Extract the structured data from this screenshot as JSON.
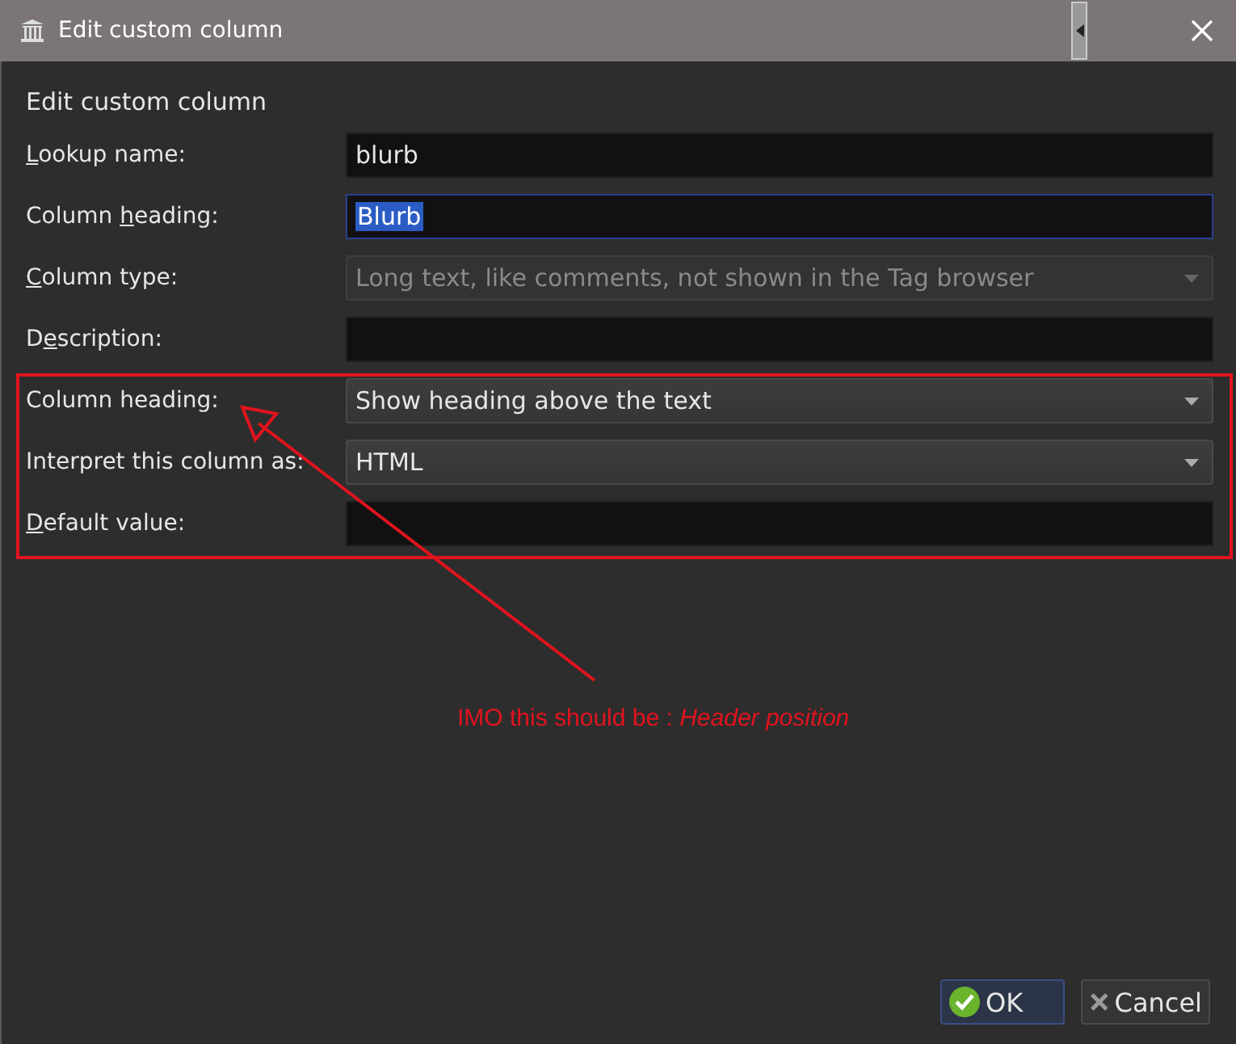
{
  "window": {
    "title": "Edit custom column"
  },
  "heading": "Edit custom column",
  "rows": [
    {
      "label_start": "",
      "access_key": "L",
      "label_end": "ookup name:",
      "kind": "text",
      "value": "blurb",
      "focused": false,
      "highlighted": false
    },
    {
      "label_start": "Column ",
      "access_key": "h",
      "label_end": "eading:",
      "kind": "text",
      "value": "Blurb",
      "focused": true,
      "highlighted": true
    },
    {
      "label_start": "",
      "access_key": "C",
      "label_end": "olumn type:",
      "kind": "combo",
      "value": "Long text, like comments, not shown in the Tag browser",
      "disabled": true
    },
    {
      "label_start": "D",
      "access_key": "e",
      "label_end": "scription:",
      "kind": "text"
    },
    {
      "label_start": "Column heading:",
      "kind": "combo",
      "value": "Show heading above the text",
      "disabled": false
    },
    {
      "label_start": "Interpret this column as:",
      "kind": "combo",
      "value": "HTML",
      "disabled": false
    },
    {
      "label_start": "",
      "access_key": "D",
      "label_end": "efault value:",
      "kind": "text"
    }
  ],
  "annotation": {
    "text": "IMO this should be : *Header position*"
  },
  "buttons": [
    {
      "label": "OK",
      "kind": "ok",
      "default": true
    },
    {
      "label": "Cancel",
      "kind": "cancel",
      "default": false
    }
  ]
}
